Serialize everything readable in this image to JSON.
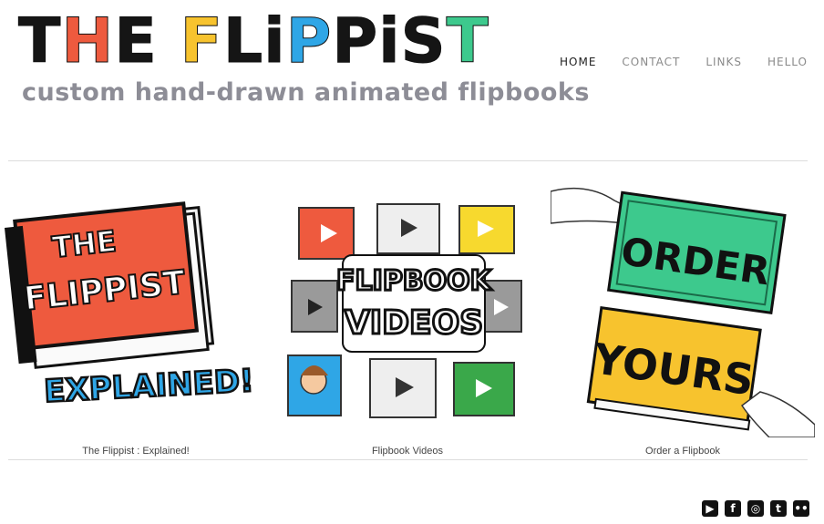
{
  "header": {
    "logo_letters": [
      {
        "ch": "T",
        "color": "black"
      },
      {
        "ch": "H",
        "color": "red"
      },
      {
        "ch": "E",
        "color": "black"
      },
      {
        "ch": " ",
        "color": "black"
      },
      {
        "ch": "F",
        "color": "yellow"
      },
      {
        "ch": "L",
        "color": "black"
      },
      {
        "ch": "i",
        "color": "black"
      },
      {
        "ch": "P",
        "color": "blue"
      },
      {
        "ch": "P",
        "color": "black"
      },
      {
        "ch": "i",
        "color": "black"
      },
      {
        "ch": "S",
        "color": "black"
      },
      {
        "ch": "T",
        "color": "green"
      }
    ],
    "tagline": "custom hand-drawn animated flipbooks"
  },
  "nav": {
    "items": [
      "HOME",
      "CONTACT",
      "LINKS",
      "HELLO"
    ],
    "active": "HOME"
  },
  "tiles": [
    {
      "caption": "The Flippist : Explained!",
      "art_text": [
        "THE",
        "FLIPPIST",
        "EXPLAINED!"
      ]
    },
    {
      "caption": "Flipbook Videos",
      "art_text": [
        "FLIPBOOK",
        "VIDEOS"
      ]
    },
    {
      "caption": "Order a Flipbook",
      "art_text": [
        "ORDER",
        "YOURS"
      ]
    }
  ],
  "social": {
    "icons": [
      "youtube-icon",
      "facebook-icon",
      "instagram-icon",
      "tumblr-icon",
      "flickr-icon"
    ]
  },
  "colors": {
    "red": "#ee5a3e",
    "yellow": "#f7c32e",
    "blue": "#2fa6e6",
    "green": "#3dc98d",
    "gray_text": "#8d8d96"
  }
}
